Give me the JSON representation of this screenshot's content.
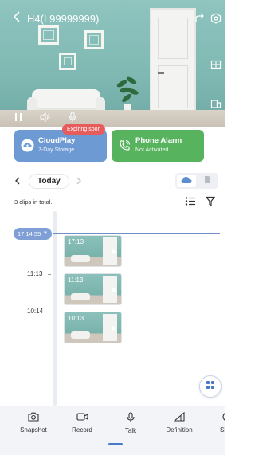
{
  "header": {
    "device_title": "H4(L99999999)"
  },
  "cards": {
    "cloud": {
      "title": "CloudPlay",
      "subtitle": "7-Day Storage",
      "badge": "Expiring soon",
      "color": "#6d9ad3"
    },
    "alarm": {
      "title": "Phone Alarm",
      "subtitle": "Not Activated",
      "color": "#58b35e"
    }
  },
  "date_nav": {
    "selected": "Today"
  },
  "clips": {
    "total_text": "3 clips in total."
  },
  "timeline": {
    "current_time": "17:14:55",
    "hour_labels": [
      "11:13",
      "10:14"
    ],
    "clips": [
      {
        "time": "17:13"
      },
      {
        "time": "11:13"
      },
      {
        "time": "10:13"
      }
    ]
  },
  "toolbar": {
    "items": [
      {
        "label": "Snapshot",
        "icon": "camera-icon"
      },
      {
        "label": "Record",
        "icon": "video-record-icon"
      },
      {
        "label": "Talk",
        "icon": "microphone-icon"
      },
      {
        "label": "Definition",
        "icon": "definition-icon"
      },
      {
        "label": "Sl",
        "icon": "partial-icon"
      }
    ]
  },
  "colors": {
    "accent": "#6f8fc7",
    "cloud_card": "#6d9ad3",
    "alarm_card": "#58b35e",
    "badge": "#e85b5b"
  }
}
